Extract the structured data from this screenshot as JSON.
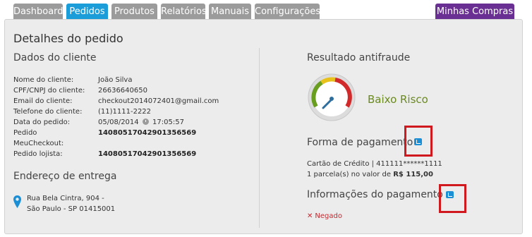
{
  "tabs": [
    {
      "label": "Dashboard",
      "active": false
    },
    {
      "label": "Pedidos",
      "active": true
    },
    {
      "label": "Produtos",
      "active": false
    },
    {
      "label": "Relatórios",
      "active": false
    },
    {
      "label": "Manuais",
      "active": false
    },
    {
      "label": "Configurações",
      "active": false
    }
  ],
  "tab_right": "Minhas Compras",
  "page_title": "Detalhes do pedido",
  "customer": {
    "heading": "Dados do cliente",
    "rows": [
      {
        "label": "Nome do cliente:",
        "value": "João Silva"
      },
      {
        "label": "CPF/CNPJ do cliente:",
        "value": "26636640650"
      },
      {
        "label": "Email do cliente:",
        "value": "checkout2014072401@gmail.com"
      },
      {
        "label": "Telefone do cliente:",
        "value": "(11)1111-2222"
      },
      {
        "label": "Data do pedido:",
        "date": "05/08/2014",
        "time": "17:05:57"
      },
      {
        "label": "Pedido",
        "value": "14080517042901356569"
      },
      {
        "label": "MeuCheckout:",
        "value": ""
      },
      {
        "label": "Pedido lojista:",
        "value": "14080517042901356569"
      }
    ]
  },
  "address": {
    "heading": "Endereço de entrega",
    "line1": "Rua Bela Cintra, 904 -",
    "line2": "São Paulo - SP 01415001"
  },
  "antifraud": {
    "heading": "Resultado antifraude",
    "result": "Baixo Risco",
    "colors": {
      "green": "#6a9e1f",
      "yellow": "#e8c21a",
      "red": "#d22a2a",
      "needle": "#2d6e9e"
    }
  },
  "payment": {
    "heading": "Forma de pagamento",
    "card_line": "Cartão de Crédito | 411111******1111",
    "installments_prefix": "1 parcela(s) no valor de",
    "installments_amount": "R$ 115,00"
  },
  "payment_info": {
    "heading": "Informações do pagamento",
    "status": "Negado"
  }
}
